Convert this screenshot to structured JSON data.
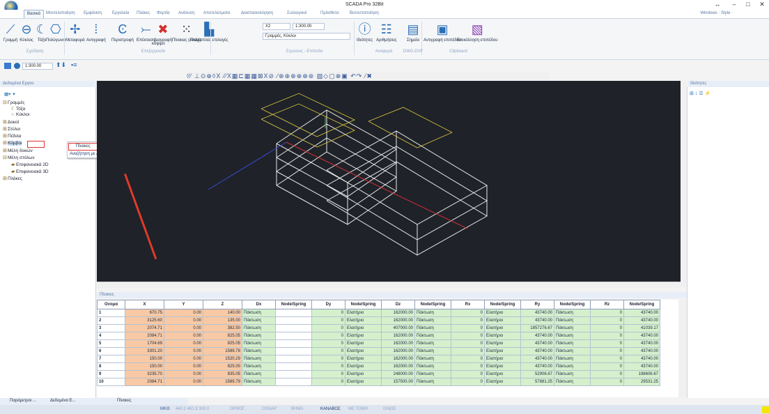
{
  "window": {
    "title": "SCADA Pro 32Bit"
  },
  "tabs": [
    "Βασικά",
    "Μοντελοποίηση",
    "Εμφάνιση",
    "Εργαλεία",
    "Πλάκες",
    "Φορτία",
    "Ανάλυση",
    "Αποτελέσματα",
    "Διαστασιολόγηση",
    "Συλλογικοί",
    "Πρόσθετα",
    "Βελτιστοποίηση"
  ],
  "windows_selector": "Windows · Style ·",
  "ribbon": {
    "shapes": [
      "Γραμμή",
      "Κύκλος",
      "Τόξο",
      "Πολύγωνο"
    ],
    "edit": [
      "Μεταφορά",
      "Αντιγραφή",
      "Περιστροφή",
      "Επέκταση",
      "Διαγραφή",
      "Πίνακας (Array)",
      "Παλλαπλές επιλογές"
    ],
    "edit_sub": "κόψιμο",
    "combo_layer": "X2",
    "combo_scale": "1:300.00",
    "combo_layer2": "Γραμμές, Κύκλοι",
    "info": [
      "Ιδιότητες",
      "Αριθμήσεις",
      "Σημεία"
    ],
    "clipboard": [
      "Αντιγραφή επιπέδου",
      "Επικόλληση επιπέδου"
    ],
    "groups": [
      "Σχεδίαση",
      "Επεξεργασία",
      "Στρώσεις - Επίπεδα",
      "Αναφορά",
      "DWG-DXF",
      "Clipboard"
    ]
  },
  "quickaccess": {
    "scale": "1:300.00"
  },
  "left_panel": {
    "title": "Δεδομένα Εργου",
    "tree": [
      "Γραμμές",
      "Τόξα",
      "Κύκλοι",
      "Δοκοί",
      "Στύλοι",
      "Πέδιλα",
      "Κόμβοι",
      "Μέλη δοκών",
      "Μέλη στύλων",
      "Επιφανειακά 2D",
      "Επιφανειακά 3D",
      "Πλάκες"
    ]
  },
  "context_menu": {
    "items": [
      "Πίνακες",
      "Αναζήτηση με Αριθμό"
    ]
  },
  "right_panel": {
    "title": "Ιδιότητες"
  },
  "grid": {
    "title": "Πίνακες",
    "columns": [
      "Ονομα",
      "X",
      "Y",
      "Z",
      "Dx",
      "Node/Spring",
      "Dy",
      "Node/Spring",
      "Dz",
      "Node/Spring",
      "Rx",
      "Node/Spring",
      "Ry",
      "Node/Spring",
      "Rz",
      "Node/Spring"
    ],
    "rows": [
      {
        "name": "1",
        "x": "670.75",
        "y": "0.00",
        "z": "140.00",
        "dx": "Πάκτωση",
        "dy": "0",
        "dy_type": "Ελατήριο",
        "dz": "162000.00",
        "dz_type": "Πάκτωση",
        "rx": "0",
        "rx_type": "Ελατήριο",
        "ry": "43740.00",
        "ry_type": "Πάκτωση",
        "rz": "0",
        "rz_type": "Ελατήριο",
        "last": "43740.00"
      },
      {
        "name": "2",
        "x": "3125.60",
        "y": "0.00",
        "z": "135.00",
        "dx": "Πάκτωση",
        "dy": "0",
        "dy_type": "Ελατήριο",
        "dz": "162000.00",
        "dz_type": "Πάκτωση",
        "rx": "0",
        "rx_type": "Ελατήριο",
        "ry": "43740.00",
        "ry_type": "Πάκτωση",
        "rz": "0",
        "rz_type": "Ελατήριο",
        "last": "43740.00"
      },
      {
        "name": "3",
        "x": "2074.71",
        "y": "0.00",
        "z": "382.50",
        "dx": "Πάκτωση",
        "dy": "0",
        "dy_type": "Ελατήριο",
        "dz": "407000.00",
        "dz_type": "Πάκτωση",
        "rx": "0",
        "rx_type": "Ελατήριο",
        "ry": "1857276.67",
        "ry_type": "Πάκτωση",
        "rz": "0",
        "rz_type": "Ελατήριο",
        "last": "41039.17"
      },
      {
        "name": "4",
        "x": "2084.71",
        "y": "0.00",
        "z": "825.05",
        "dx": "Πάκτωση",
        "dy": "0",
        "dy_type": "Ελατήριο",
        "dz": "162000.00",
        "dz_type": "Πάκτωση",
        "rx": "0",
        "rx_type": "Ελατήριο",
        "ry": "43740.00",
        "ry_type": "Πάκτωση",
        "rz": "0",
        "rz_type": "Ελατήριο",
        "last": "43740.00"
      },
      {
        "name": "5",
        "x": "1704.69",
        "y": "0.00",
        "z": "825.05",
        "dx": "Πάκτωση",
        "dy": "0",
        "dy_type": "Ελατήριο",
        "dz": "162000.00",
        "dz_type": "Πάκτωση",
        "rx": "0",
        "rx_type": "Ελατήριο",
        "ry": "43740.00",
        "ry_type": "Πάκτωση",
        "rz": "0",
        "rz_type": "Ελατήριο",
        "last": "43740.00"
      },
      {
        "name": "6",
        "x": "3301.20",
        "y": "0.00",
        "z": "1589.78",
        "dx": "Πάκτωση",
        "dy": "0",
        "dy_type": "Ελατήριο",
        "dz": "162000.00",
        "dz_type": "Πάκτωση",
        "rx": "0",
        "rx_type": "Ελατήριο",
        "ry": "43740.00",
        "ry_type": "Πάκτωση",
        "rz": "0",
        "rz_type": "Ελατήριο",
        "last": "43740.00"
      },
      {
        "name": "7",
        "x": "150.00",
        "y": "0.00",
        "z": "1520.29",
        "dx": "Πάκτωση",
        "dy": "0",
        "dy_type": "Ελατήριο",
        "dz": "162000.00",
        "dz_type": "Πάκτωση",
        "rx": "0",
        "rx_type": "Ελατήριο",
        "ry": "43740.00",
        "ry_type": "Πάκτωση",
        "rz": "0",
        "rz_type": "Ελατήριο",
        "last": "43740.00"
      },
      {
        "name": "8",
        "x": "150.00",
        "y": "0.00",
        "z": "825.00",
        "dx": "Πάκτωση",
        "dy": "0",
        "dy_type": "Ελατήριο",
        "dz": "162000.00",
        "dz_type": "Πάκτωση",
        "rx": "0",
        "rx_type": "Ελατήριο",
        "ry": "43740.00",
        "ry_type": "Πάκτωση",
        "rz": "0",
        "rz_type": "Ελατήριο",
        "last": "43740.00"
      },
      {
        "name": "9",
        "x": "3235.70",
        "y": "0.00",
        "z": "835.05",
        "dx": "Πάκτωση",
        "dy": "0",
        "dy_type": "Ελατήριο",
        "dz": "248000.00",
        "dz_type": "Πάκτωση",
        "rx": "0",
        "rx_type": "Ελατήριο",
        "ry": "52906.67",
        "ry_type": "Πάκτωση",
        "rz": "0",
        "rz_type": "Ελατήριο",
        "last": "198606.67"
      },
      {
        "name": "10",
        "x": "2084.71",
        "y": "0.00",
        "z": "1569.79",
        "dx": "Πάκτωση",
        "dy": "0",
        "dy_type": "Ελατήριο",
        "dz": "157500.00",
        "dz_type": "Πάκτωση",
        "rx": "0",
        "rx_type": "Ελατήριο",
        "ry": "57881.25",
        "ry_type": "Πάκτωση",
        "rz": "0",
        "rz_type": "Ελατήριο",
        "last": "29531.25"
      }
    ]
  },
  "bottom_tabs": [
    "Παράμετροι ...",
    "Δεδομένα Ε...",
    "Πίνακες"
  ],
  "status": {
    "units": "MKΘ",
    "coords": "440.2  461.9  300.0",
    "toggles": [
      "ΟΡΘΟΓ.",
      "OSNAP",
      "ΒΗΜΑ",
      "ΚΑΝΑΒΟΣ",
      "ΜΕ ΤΟΜΗ",
      "ΙΧΝΟΣ"
    ]
  }
}
